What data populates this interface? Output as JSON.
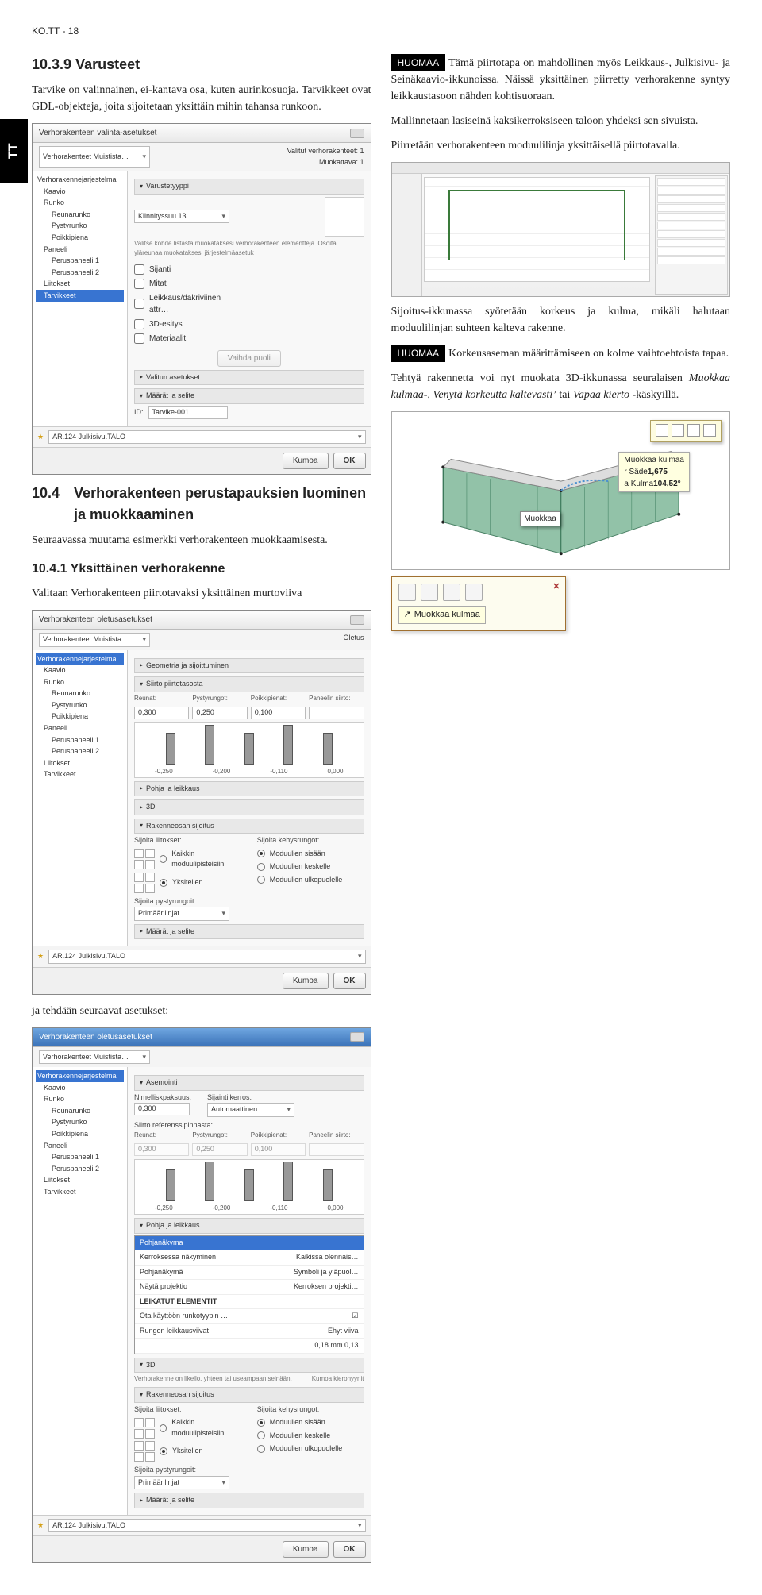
{
  "page_header": "KO.TT - 18",
  "tab": "TT",
  "left": {
    "h1_num": "10.3.9",
    "h1_text": "Varusteet",
    "p1": "Tarvike on valinnainen, ei-kantava osa, kuten aurinkosuoja. Tarvikkeet ovat GDL-objekteja, joita sijoitetaan yksittäin mihin tahansa runkoon.",
    "h2_num": "10.4",
    "h2_text": "Verhorakenteen perustapauksien luominen ja muokkaaminen",
    "p2": "Seuraavassa muutama esimerkki verhorakenteen muokkaamisesta.",
    "h3_num": "10.4.1",
    "h3_text": "Yksittäinen verhorakenne",
    "p3": "Valitaan Verhorakenteen piirtotavaksi yksittäinen murtoviiva",
    "p4": "ja tehdään seuraavat asetukset:"
  },
  "right": {
    "huomaa": "HUOMAA",
    "p1": "Tämä piirtotapa on mahdollinen myös Leikkaus-, Julkisivu- ja Seinäkaavio-ikkunoissa. Näissä yksittäinen piirretty verhorakenne syntyy leikkaustasoon nähden kohtisuoraan.",
    "p2": "Mallinnetaan lasiseinä kaksikerroksiseen taloon yhdeksi sen sivuista.",
    "p3": "Piirretään verhorakenteen moduulilinja yksittäisellä piirtotavalla.",
    "p4": "Sijoitus-ikkunassa syötetään korkeus ja kulma, mikäli halutaan moduulilinjan suhteen kalteva rakenne.",
    "p5": "Korkeusaseman määrittämiseen on kolme vaihtoehtoista tapaa.",
    "p6a": "Tehtyä rakennetta voi nyt muokata 3D-ikkunassa seuralaisen ",
    "p6b": "Muokkaa kulmaa-, Venytä korkeutta kaltevastiʼ ",
    "p6c": "tai",
    "p6d": " Vapaa kierto",
    "p6e": " -käskyillä."
  },
  "ss1": {
    "title": "Verhorakenteen valinta-asetukset",
    "muistista": "Verhorakenteet Muistista…",
    "valitut": "Valitut verhorakenteet: 1",
    "muokattava": "Muokattava: 1",
    "varustetyyppi": "Varustetyyppi",
    "kiinnitys": "Kiinnityssuu 13",
    "tree": [
      "Verhorakennejarjestelma",
      "Kaavio",
      "Runko",
      "Reunarunko",
      "Pystyrunko",
      "Poikkipiena",
      "Paneeli",
      "Peruspaneeli 1",
      "Peruspaneeli 2",
      "Liitokset",
      "Tarvikkeet"
    ],
    "opts": [
      "Sijanti",
      "Mitat",
      "Leikkaus/dakriviinen attr…",
      "3D-esitys",
      "Materiaalit"
    ],
    "vaihda": "Vaihda puoli",
    "valitun": "Valitun asetukset",
    "maarat": "Määrät ja selite",
    "id_label": "ID:",
    "id_val": "Tarvike-001",
    "fav": "AR.124 Julkisivu.TALO",
    "kumoa": "Kumoa",
    "ok": "OK"
  },
  "ss2": {
    "title": "Verhorakenteen oletusasetukset",
    "oletus": "Oletus",
    "geom": "Geometria ja sijoittuminen",
    "siirto": "Siirto piirtotasosta",
    "hdrs": [
      "Reunat:",
      "Pystyrungot:",
      "Poikkipienat:",
      "Paneelin siirto:"
    ],
    "vals1": [
      "0,300",
      "0,250",
      "0,100",
      ""
    ],
    "ticks": [
      "-0,250",
      "-0,200",
      "-0,110",
      "0,000"
    ],
    "pohja": "Pohja ja leikkaus",
    "kolmed": "3D",
    "rakenneosan": "Rakenneosan sijoitus",
    "sij_lit": "Sijoita liitokset:",
    "sij_keh": "Sijoita kehysrungot:",
    "r1": "Kaikkin moduulipisteisiin",
    "r2": "Yksitellen",
    "r3": "Moduulien sisään",
    "r4": "Moduulien keskelle",
    "r5": "Moduulien ulkopuolelle",
    "sij_pysty": "Sijoita pystyrungoit:",
    "primaari": "Primäärilinjat",
    "maarat": "Määrät ja selite",
    "fav": "AR.124 Julkisivu.TALO",
    "kumoa": "Kumoa",
    "ok": "OK"
  },
  "ss3": {
    "title": "Verhorakenteen oletusasetukset",
    "muistista": "Verhorakenteet Muistista…",
    "asemointi": "Asemointi",
    "nimelliskp": "Nimelliskpaksuus:",
    "nimval": "0,300",
    "sijaintibk": "Sijaintiikerros:",
    "sijval": "Automaattinen",
    "siirto_ref": "Siirto referenssipinnasta:",
    "hdrs": [
      "Reunat:",
      "Pystyrungot:",
      "Poikkipienat:",
      "Paneelin siirto:"
    ],
    "vals1": [
      "0,300",
      "0,250",
      "0,100",
      ""
    ],
    "ticks": [
      "-0,250",
      "-0,200",
      "-0,110",
      "0,000"
    ],
    "pohja": "Pohja ja leikkaus",
    "pohjanakyma_hdr": "Pohjanäkyma",
    "menu": [
      [
        "Kerroksessa näkyminen",
        "Kaikissa olennais…"
      ],
      [
        "Pohjanäkymä",
        "Symboli ja yläpuol…"
      ],
      [
        "Näytä projektio",
        "Kerroksen projekti…"
      ]
    ],
    "leikatut": "LEIKATUT ELEMENTIT",
    "ota": "Ota käyttöön runkotyypin …",
    "rungon": "Rungon leikkausviivat",
    "ehyt": "Ehyt viiva",
    "num1": "0,18",
    "num2": "mm",
    "num3": "0,13",
    "kolmed": "3D",
    "verh_note": "Verhorakenne on likello, yhteen tai useampaan seinään.",
    "kumoa_note": "Kumoa kierohyynit",
    "rakenneosan": "Rakenneosan sijoitus",
    "sij_lit": "Sijoita liitokset:",
    "sij_keh": "Sijoita kehysrungot:",
    "r1": "Kaikkin moduulipisteisiin",
    "r2": "Yksitellen",
    "r3": "Moduulien sisään",
    "r4": "Moduulien keskelle",
    "r5": "Moduulien ulkopuolelle",
    "sij_pysty": "Sijoita pystyrungoit:",
    "primaari": "Primäärilinjat",
    "maarat": "Määrät ja selite",
    "fav": "AR.124 Julkisivu.TALO",
    "kumoa": "Kumoa",
    "ok": "OK"
  },
  "iso": {
    "sade": "r Säde",
    "sade_v": "1,675",
    "kulma": "a Kulma",
    "kulma_v": "104,52°",
    "muokkaa_tip": "Muokkaa kulmaa",
    "muokkaa_tag": "Muokkaa"
  },
  "toolpopup": {
    "label": "Muokkaa kulmaa"
  }
}
